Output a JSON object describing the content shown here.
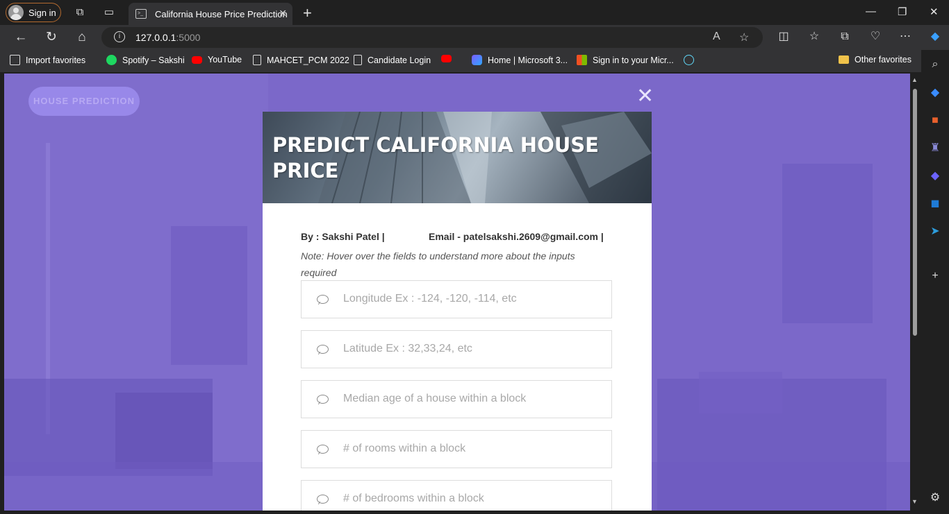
{
  "browser": {
    "signin_label": "Sign in",
    "tab_title": "California House Price Prediction",
    "url_host": "127.0.0.1",
    "url_port": ":5000",
    "bookmarks": [
      {
        "label": "Import favorites",
        "icon": "import-icon"
      },
      {
        "label": "Spotify – Sakshi",
        "icon": "spotify-icon"
      },
      {
        "label": "YouTube",
        "icon": "youtube-icon"
      },
      {
        "label": "MAHCET_PCM 2022",
        "icon": "page-icon"
      },
      {
        "label": "Candidate Login",
        "icon": "page-icon"
      },
      {
        "label": "",
        "icon": "youtube-icon"
      },
      {
        "label": "Home | Microsoft 3...",
        "icon": "microsoft-365-icon"
      },
      {
        "label": "Sign in to your Micr...",
        "icon": "microsoft-icon"
      },
      {
        "label": "",
        "icon": "react-icon"
      }
    ],
    "other_favorites": "Other favorites"
  },
  "page": {
    "nav_pill": "HOUSE PREDICTION",
    "close_symbol": "✕",
    "title": "PREDICT CALIFORNIA HOUSE PRICE",
    "byline": "By : Sakshi Patel |",
    "email": "Email - patelsakshi.2609@gmail.com |",
    "note": "Note: Hover over the fields to understand more about the inputs required",
    "fields": [
      {
        "placeholder": "Longitude Ex : -124, -120, -114, etc"
      },
      {
        "placeholder": "Latitude Ex : 32,33,24, etc"
      },
      {
        "placeholder": "Median age of a house within a block"
      },
      {
        "placeholder": "# of rooms within a block"
      },
      {
        "placeholder": "# of bedrooms within a block"
      }
    ]
  },
  "colors": {
    "overlay": "#7b68c9",
    "pill": "#9a8aea",
    "browser_dark": "#202020",
    "browser_bar": "#333335"
  }
}
